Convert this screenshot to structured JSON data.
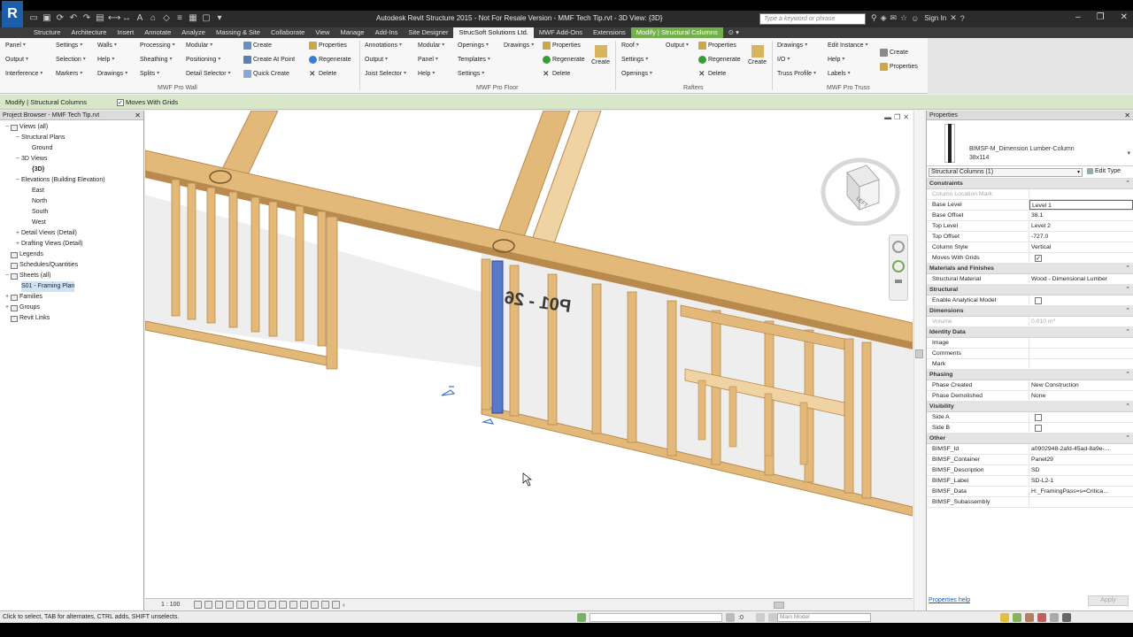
{
  "app": {
    "logo": "R",
    "title": "Autodesk Revit Structure 2015 - Not For Resale Version -    MMF Tech Tip.rvt - 3D View: {3D}",
    "search_placeholder": "Type a keyword or phrase",
    "sign_in": "Sign In",
    "accent": "#74b04a"
  },
  "tabs": [
    {
      "label": "Structure"
    },
    {
      "label": "Architecture"
    },
    {
      "label": "Insert"
    },
    {
      "label": "Annotate"
    },
    {
      "label": "Analyze"
    },
    {
      "label": "Massing & Site"
    },
    {
      "label": "Collaborate"
    },
    {
      "label": "View"
    },
    {
      "label": "Manage"
    },
    {
      "label": "Add-Ins"
    },
    {
      "label": "Site Designer"
    },
    {
      "label": "StrucSoft Solutions Ltd."
    },
    {
      "label": "MWF Add-Ons"
    },
    {
      "label": "Extensions"
    },
    {
      "label": "Modify | Structural Columns"
    }
  ],
  "ribbon": {
    "wall": {
      "col1": [
        "Panel",
        "Output",
        "Interference"
      ],
      "col2": [
        "Settings",
        "Selection",
        "Markers"
      ],
      "col3": [
        "Walls",
        "Help",
        "Drawings"
      ],
      "col4": [
        "Processing",
        "Sheathing",
        "Splits"
      ],
      "col5": [
        "Modular",
        "Positioning",
        "Detail Selector"
      ],
      "col6": [
        "Create",
        "Create At Point",
        "Quick Create"
      ],
      "col7": [
        "Properties",
        "Regenerate",
        "Delete"
      ],
      "label": "MWF Pro Wall"
    },
    "floor": {
      "col1": [
        "Annotations",
        "Output",
        "Joist Selector"
      ],
      "col2": [
        "Modular",
        "Panel",
        "Help"
      ],
      "col3": [
        "Openings",
        "Templates",
        "Settings"
      ],
      "col4": [
        "Drawings"
      ],
      "col5": [
        "Properties",
        "Regenerate",
        "Delete"
      ],
      "create": "Create",
      "label": "MWF Pro Floor"
    },
    "rafters": {
      "col1": [
        "Roof",
        "Settings",
        "Openings"
      ],
      "output": "Output",
      "col3": [
        "Properties",
        "Regenerate",
        "Delete"
      ],
      "create": "Create",
      "label": "Rafters"
    },
    "truss": {
      "col1": [
        "Drawings",
        "I/O",
        "Truss Profile"
      ],
      "col2": [
        "Edit Instance",
        "Help",
        "Labels"
      ],
      "col3": [
        "Create",
        "Properties"
      ],
      "label": "MWF Pro Truss"
    }
  },
  "options_bar": {
    "context": "Modify | Structural Columns",
    "moves_with_grids": "Moves With Grids"
  },
  "project_browser": {
    "title": "Project Browser - MMF Tech Tip.rvt",
    "nodes": [
      {
        "label": "Views (all)",
        "indent": 0,
        "exp": "−",
        "icon": true
      },
      {
        "label": "Structural Plans",
        "indent": 1,
        "exp": "−"
      },
      {
        "label": "Ground",
        "indent": 2,
        "exp": ""
      },
      {
        "label": "3D Views",
        "indent": 1,
        "exp": "−"
      },
      {
        "label": "{3D}",
        "indent": 2,
        "exp": "",
        "bold": true
      },
      {
        "label": "Elevations (Building Elevation)",
        "indent": 1,
        "exp": "−"
      },
      {
        "label": "East",
        "indent": 2,
        "exp": ""
      },
      {
        "label": "North",
        "indent": 2,
        "exp": ""
      },
      {
        "label": "South",
        "indent": 2,
        "exp": ""
      },
      {
        "label": "West",
        "indent": 2,
        "exp": ""
      },
      {
        "label": "Detail Views (Detail)",
        "indent": 1,
        "exp": "+"
      },
      {
        "label": "Drafting Views (Detail)",
        "indent": 1,
        "exp": "+"
      },
      {
        "label": "Legends",
        "indent": 0,
        "exp": "",
        "icon": true
      },
      {
        "label": "Schedules/Quantities",
        "indent": 0,
        "exp": "",
        "icon": true
      },
      {
        "label": "Sheets (all)",
        "indent": 0,
        "exp": "−",
        "icon": true
      },
      {
        "label": "S01 - Framing Plan",
        "indent": 1,
        "exp": "",
        "sel": true
      },
      {
        "label": "Families",
        "indent": 0,
        "exp": "+",
        "icon": true
      },
      {
        "label": "Groups",
        "indent": 0,
        "exp": "+",
        "icon": true
      },
      {
        "label": "Revit Links",
        "indent": 0,
        "exp": "",
        "icon": true
      }
    ]
  },
  "viewport": {
    "scale": "1 : 100",
    "panel_text": "P01 - 26",
    "viewcube_face": "LEFT"
  },
  "properties": {
    "title": "Properties",
    "type_name_line1": "BIMSF-M_Dimension Lumber-Column",
    "type_name_line2": "38x114",
    "instance_filter": "Structural Columns (1)",
    "edit_type": "Edit Type",
    "help_link": "Properties help",
    "apply": "Apply",
    "groups": [
      {
        "name": "Constraints",
        "rows": [
          {
            "k": "Column Location Mark",
            "v": "",
            "grey": true
          },
          {
            "k": "Base Level",
            "v": "Level 1",
            "hl": true
          },
          {
            "k": "Base Offset",
            "v": "38.1"
          },
          {
            "k": "Top Level",
            "v": "Level 2"
          },
          {
            "k": "Top Offset",
            "v": "-727.0"
          },
          {
            "k": "Column Style",
            "v": "Vertical"
          },
          {
            "k": "Moves With Grids",
            "v": "",
            "check": true
          }
        ]
      },
      {
        "name": "Materials and Finishes",
        "rows": [
          {
            "k": "Structural Material",
            "v": "Wood - Dimensional Lumber"
          }
        ]
      },
      {
        "name": "Structural",
        "rows": [
          {
            "k": "Enable Analytical Model",
            "v": "",
            "check": false
          }
        ]
      },
      {
        "name": "Dimensions",
        "rows": [
          {
            "k": "Volume",
            "v": "0.010 m³",
            "grey": true
          }
        ]
      },
      {
        "name": "Identity Data",
        "rows": [
          {
            "k": "Image",
            "v": ""
          },
          {
            "k": "Comments",
            "v": ""
          },
          {
            "k": "Mark",
            "v": ""
          }
        ]
      },
      {
        "name": "Phasing",
        "rows": [
          {
            "k": "Phase Created",
            "v": "New Construction"
          },
          {
            "k": "Phase Demolished",
            "v": "None"
          }
        ]
      },
      {
        "name": "Visibility",
        "rows": [
          {
            "k": "Side A",
            "v": "",
            "check": false
          },
          {
            "k": "Side B",
            "v": "",
            "check": false
          }
        ]
      },
      {
        "name": "Other",
        "rows": [
          {
            "k": "BIMSF_Id",
            "v": "a0902948-2afd-45ad-8a9e-..."
          },
          {
            "k": "BIMSF_Container",
            "v": "Panel29"
          },
          {
            "k": "BIMSF_Description",
            "v": "SD"
          },
          {
            "k": "BIMSF_Label",
            "v": "SD-L2-1"
          },
          {
            "k": "BIMSF_Data",
            "v": "H:_FramingPass=s=Critica..."
          },
          {
            "k": "BIMSF_Subassembly",
            "v": ""
          }
        ]
      }
    ]
  },
  "status": {
    "text": "Click to select, TAB for alternates, CTRL adds, SHIFT unselects.",
    "model": "Main Model",
    "value": ":0"
  }
}
